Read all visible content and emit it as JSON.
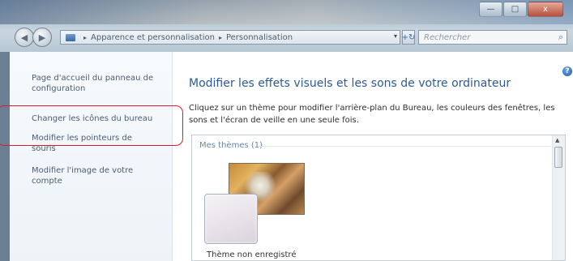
{
  "window": {
    "controls": {
      "minimize": "—",
      "maximize": "□",
      "close": "x"
    }
  },
  "navigation": {
    "back_glyph": "◀",
    "forward_glyph": "▶",
    "breadcrumb": [
      "Apparence et personnalisation",
      "Personnalisation"
    ],
    "breadcrumb_separator": "▸",
    "dropdown_glyph": "▾",
    "refresh_glyph": "+↻",
    "search_placeholder": "Rechercher",
    "search_icon": "⌕"
  },
  "sidebar": {
    "items": [
      {
        "label": "Page d'accueil du panneau de configuration"
      },
      {
        "label": "Changer les icônes du bureau"
      },
      {
        "label": "Modifier les pointeurs de souris"
      },
      {
        "label": "Modifier l'image de votre compte"
      }
    ]
  },
  "main": {
    "help_glyph": "?",
    "title": "Modifier les effets visuels et les sons de votre ordinateur",
    "description": "Cliquez sur un thème pour modifier l'arrière-plan du Bureau, les couleurs des fenêtres, les sons et l'écran de veille en une seule fois.",
    "gallery": {
      "group_header": "Mes thèmes (1)",
      "scroll_up_glyph": "▲",
      "themes": [
        {
          "name": "Thème non enregistré"
        }
      ]
    }
  },
  "colors": {
    "highlight": "#d81e2d",
    "title": "#2a5a97",
    "link": "#4b5d72"
  }
}
